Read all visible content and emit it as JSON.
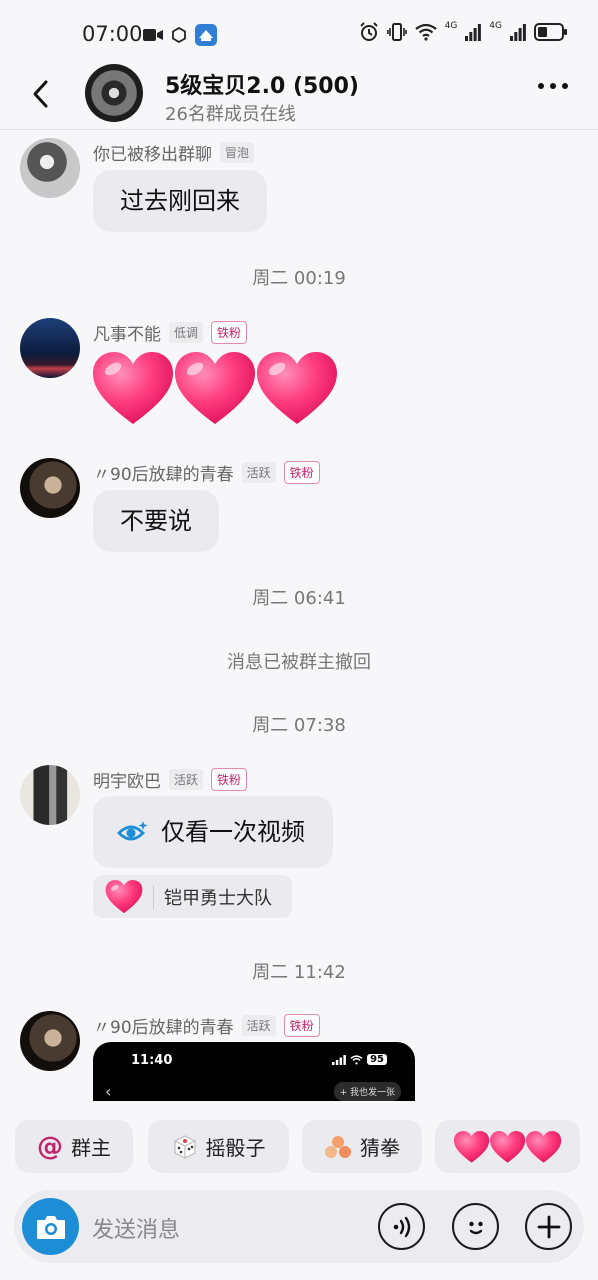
{
  "status_bar": {
    "time": "07:00",
    "left_icons": [
      "video-icon",
      "hexagon-icon",
      "app-notification-icon"
    ],
    "right_icons": [
      "alarm-icon",
      "vibrate-icon",
      "wifi-icon",
      "signal-4g-icon",
      "signal-4g-icon-2",
      "battery-icon"
    ],
    "network_label_1": "4G",
    "network_label_2": "4G"
  },
  "header": {
    "title": "5级宝贝2.0 (500)",
    "subtitle": "26名群成员在线"
  },
  "messages": [
    {
      "sender": "你已被移出群聊",
      "tags": [
        "冒泡"
      ],
      "text": "过去刚回来"
    },
    {
      "time": "周二 00:19"
    },
    {
      "sender": "凡事不能",
      "tags": [
        "低调",
        "铁粉"
      ],
      "type": "hearts",
      "count": 3
    },
    {
      "sender": "〃90后放肆的青春",
      "tags": [
        "活跃",
        "铁粉"
      ],
      "text": "不要说"
    },
    {
      "time": "周二 06:41"
    },
    {
      "system": "消息已被群主撤回"
    },
    {
      "time": "周二 07:38"
    },
    {
      "sender": "明宇欧巴",
      "tags": [
        "活跃",
        "铁粉"
      ],
      "text": "仅看一次视频",
      "icon": "view-once-icon",
      "reaction": "铠甲勇士大队"
    },
    {
      "time": "周二 11:42"
    },
    {
      "sender": "〃90后放肆的青春",
      "tags": [
        "活跃",
        "铁粉"
      ],
      "type": "image",
      "image": {
        "time": "11:40",
        "battery": "95",
        "pill": "+ 我也发一张"
      }
    }
  ],
  "quick_actions": [
    {
      "label": "群主",
      "icon": "at-icon"
    },
    {
      "label": "摇骰子",
      "icon": "dice-icon"
    },
    {
      "label": "猜拳",
      "icon": "rock-paper-scissors-icon"
    },
    {
      "label": "",
      "icon": "three-hearts-icon"
    }
  ],
  "input": {
    "placeholder": "发送消息"
  },
  "colors": {
    "accent": "#1d8ed6",
    "heart": "#ff3d7f",
    "tag_pink": "#c2266c"
  }
}
